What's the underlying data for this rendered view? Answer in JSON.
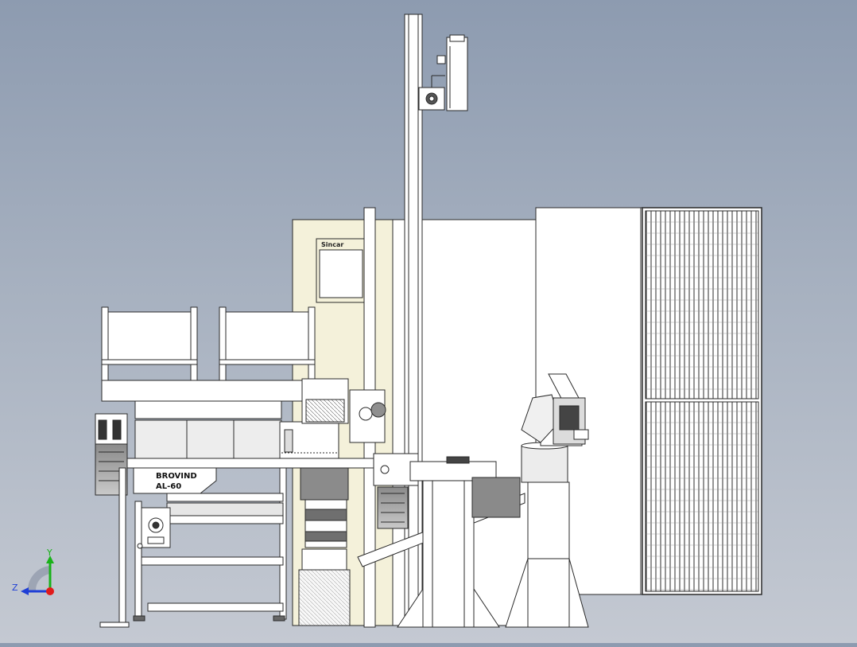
{
  "viewport": {
    "background_top": "#8d9bb0",
    "background_bottom": "#c4c9d2",
    "line_color": "#2a2a2a",
    "panel_color": "#f4f1da",
    "fill_light": "#ececec",
    "fill_dark": "#6f6f6f"
  },
  "labels": {
    "brand_line1": "BROVIND",
    "brand_line2": "AL-60",
    "machine_plate": "Sincar"
  },
  "triad": {
    "y_label": "Y",
    "z_label": "Z",
    "x_color": "#e11b1b",
    "y_color": "#19b219",
    "z_color": "#1f3fd6"
  }
}
